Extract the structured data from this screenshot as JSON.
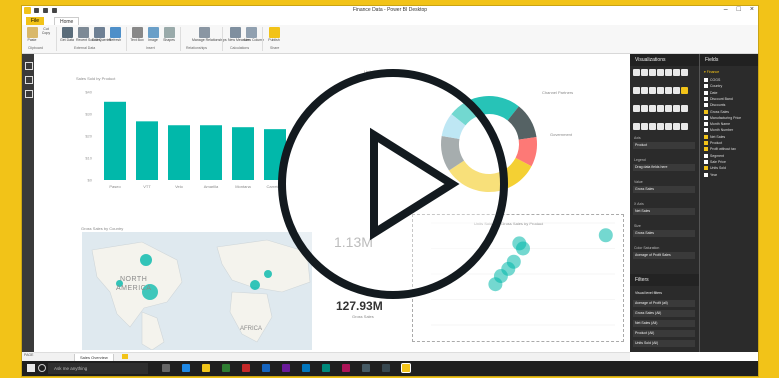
{
  "window": {
    "title": "Finance Data - Power BI Desktop",
    "tabs": [
      "File",
      "Home"
    ]
  },
  "ribbon": {
    "groups": [
      "Clipboard",
      "External Data",
      "Insert",
      "Relationships",
      "Calculations",
      "Share"
    ],
    "buttons": [
      "Paste",
      "Cut",
      "Copy",
      "Get Data",
      "Recent Sources",
      "Edit Queries",
      "Refresh",
      "Text Box",
      "Image",
      "Shapes",
      "Manage Relationships",
      "New Measure",
      "New Column",
      "Publish"
    ]
  },
  "canvas": {
    "bar_title": "Sales Sold by Product",
    "donut_title": "Units Sold by Segment",
    "map_title": "Gross Sales by Country",
    "scatter_title": "Units Sold and Gross Sales by Product",
    "card1_value": "1.13M",
    "card2_value": "127.93M",
    "card2_label": "Gross Sales",
    "map_labels": [
      "NORTH",
      "AMERICA",
      "AFRICA"
    ],
    "donut_labels": [
      "Channel Partners",
      "Government"
    ]
  },
  "chart_data": [
    {
      "type": "bar",
      "categories": [
        "Paseo",
        "VTT",
        "Velo",
        "Amarilla",
        "Montana",
        "Carretera"
      ],
      "values": [
        40,
        30,
        28,
        28,
        27,
        26
      ],
      "ytick_labels": [
        "$40",
        "$30",
        "$20",
        "$10",
        "$0"
      ],
      "ylim": [
        0,
        45
      ]
    },
    {
      "type": "pie",
      "values": [
        25,
        12,
        10,
        33,
        12,
        8
      ],
      "colors": [
        "#01B8AA",
        "#374649",
        "#FD625E",
        "#F2C80F",
        "#5F6B6D",
        "#8AD4EB"
      ]
    },
    {
      "type": "scatter",
      "points": [
        [
          0.42,
          0.55
        ],
        [
          0.5,
          0.75
        ],
        [
          0.45,
          0.62
        ],
        [
          0.38,
          0.48
        ],
        [
          0.48,
          0.8
        ],
        [
          0.95,
          0.88
        ],
        [
          0.35,
          0.4
        ]
      ]
    }
  ],
  "visualizations": {
    "header": "Visualizations",
    "wells": [
      {
        "label": "Axis",
        "value": "Product"
      },
      {
        "label": "Legend",
        "value": "Drag data fields here"
      },
      {
        "label": "Value",
        "value": "Gross Sales"
      },
      {
        "label": "X Axis",
        "value": "Net Sales"
      },
      {
        "label": "Size",
        "value": "Gross Sales"
      },
      {
        "label": "Color Saturation",
        "value": "Average of Profit Sales"
      }
    ],
    "filters_header": "Filters",
    "filters": [
      "Visual level filters",
      "Average of Profit (all)",
      "Gross Sales (All)",
      "Net Sales (All)",
      "Product (All)",
      "Units Sold (All)"
    ]
  },
  "fields": {
    "header": "Fields",
    "table": "Finance",
    "items": [
      {
        "name": "COGS",
        "checked": false
      },
      {
        "name": "Country",
        "checked": false
      },
      {
        "name": "Date",
        "checked": false
      },
      {
        "name": "Discount Band",
        "checked": false
      },
      {
        "name": "Discounts",
        "checked": false
      },
      {
        "name": "Gross Sales",
        "checked": true
      },
      {
        "name": "Manufacturing Price",
        "checked": false
      },
      {
        "name": "Month Name",
        "checked": false
      },
      {
        "name": "Month Number",
        "checked": false
      },
      {
        "name": "Net Sales",
        "checked": true
      },
      {
        "name": "Product",
        "checked": true
      },
      {
        "name": "Profit without tax",
        "checked": true
      },
      {
        "name": "Segment",
        "checked": false
      },
      {
        "name": "Sale Price",
        "checked": false
      },
      {
        "name": "Units Sold",
        "checked": true
      },
      {
        "name": "Year",
        "checked": false
      }
    ]
  },
  "pages": {
    "active": "Sales Overview"
  },
  "statusbar": {
    "text": "PAGE 1 OF 1"
  },
  "taskbar": {
    "search_placeholder": "Ask me anything"
  },
  "colors": {
    "accent": "#F2C318",
    "teal": "#01B8AA",
    "dark_panel": "#2b2b2b"
  }
}
